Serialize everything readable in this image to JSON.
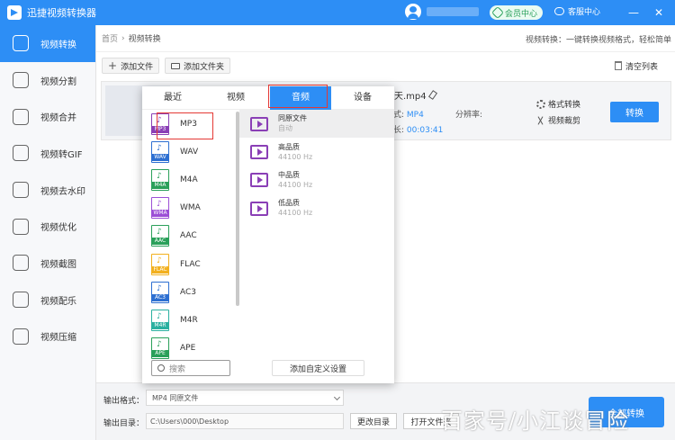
{
  "app": {
    "title": "迅捷视频转换器"
  },
  "header": {
    "vip_label": "会员中心",
    "service_label": "客服中心",
    "minimize": "—",
    "close": "✕"
  },
  "sidebar": {
    "items": [
      {
        "label": "视频转换",
        "active": true
      },
      {
        "label": "视频分割"
      },
      {
        "label": "视频合并"
      },
      {
        "label": "视频转GIF"
      },
      {
        "label": "视频去水印"
      },
      {
        "label": "视频优化"
      },
      {
        "label": "视频截图"
      },
      {
        "label": "视频配乐"
      },
      {
        "label": "视频压缩"
      }
    ]
  },
  "breadcrumb": {
    "home": "首页",
    "sep": "›",
    "current": "视频转换"
  },
  "tip": "视频转换：一键转换视频格式，轻松简单",
  "toolbar": {
    "add_file": "添加文件",
    "add_folder": "添加文件夹",
    "clear_list": "清空列表"
  },
  "file": {
    "name": "夏天.mp4",
    "format_label": "格式:",
    "format_value": "MP4",
    "resolution_label": "分辨率:",
    "duration_label": "时长:",
    "duration_value": "00:03:41",
    "format_convert": "格式转换",
    "video_crop": "视频裁剪",
    "convert_button": "转换"
  },
  "popup": {
    "tabs": [
      "最近",
      "视频",
      "音频",
      "设备"
    ],
    "active_tab": "音频",
    "formats": [
      {
        "name": "MP3",
        "badge": "MP3",
        "color": "#8a3fb6"
      },
      {
        "name": "WAV",
        "badge": "WAV",
        "color": "#2d6fd1"
      },
      {
        "name": "M4A",
        "badge": "M4A",
        "color": "#2aa05a"
      },
      {
        "name": "WMA",
        "badge": "WMA",
        "color": "#9c4fd6"
      },
      {
        "name": "AAC",
        "badge": "AAC",
        "color": "#2aa05a"
      },
      {
        "name": "FLAC",
        "badge": "FLAC",
        "color": "#f2b01e"
      },
      {
        "name": "AC3",
        "badge": "AC3",
        "color": "#2d6fd1"
      },
      {
        "name": "M4R",
        "badge": "M4R",
        "color": "#2ab0a0"
      },
      {
        "name": "APE",
        "badge": "APE",
        "color": "#2aa05a"
      }
    ],
    "qualities": [
      {
        "name": "同原文件",
        "sub": "自动"
      },
      {
        "name": "高品质",
        "sub": "44100 Hz"
      },
      {
        "name": "中品质",
        "sub": "44100 Hz"
      },
      {
        "name": "低品质",
        "sub": "44100 Hz"
      }
    ],
    "search_placeholder": "搜索",
    "custom_button": "添加自定义设置"
  },
  "bottom": {
    "output_format_label": "输出格式：",
    "output_format_value": "MP4  同原文件",
    "output_dir_label": "输出目录：",
    "output_dir_value": "C:\\Users\\000\\Desktop",
    "change_dir": "更改目录",
    "open_folder": "打开文件夹",
    "convert_all": "全部转换"
  },
  "watermark": "百家号/小江谈冒险"
}
